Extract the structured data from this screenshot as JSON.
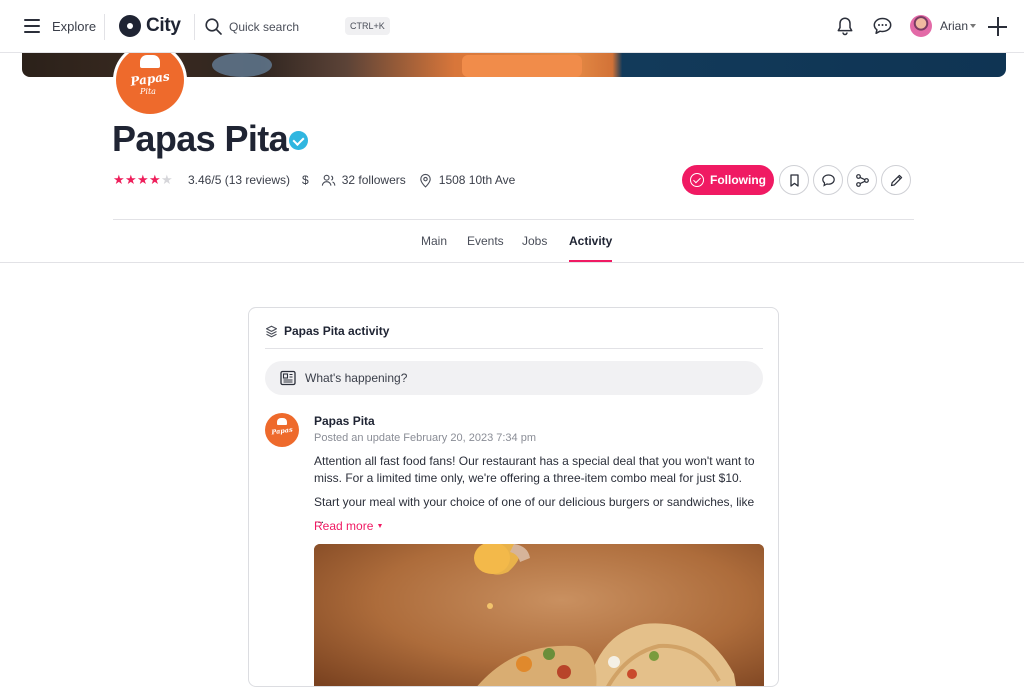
{
  "nav": {
    "explore_label": "Explore",
    "logo_text": "City",
    "search_placeholder": "Quick search",
    "search_shortcut": "CTRL+K",
    "user_name": "Arian"
  },
  "business": {
    "name": "Papas Pita",
    "logo_text_main": "Papas",
    "logo_text_sub": "Pita",
    "rating_stars": 4,
    "rating_max_stars": 5,
    "rating_text": "3.46/5 (13 reviews)",
    "price_level": "$",
    "followers_text": "32 followers",
    "address": "1508 10th Ave"
  },
  "actions": {
    "follow_label": "Following"
  },
  "tabs": [
    {
      "label": "Main"
    },
    {
      "label": "Events"
    },
    {
      "label": "Jobs"
    },
    {
      "label": "Activity"
    }
  ],
  "activity": {
    "title": "Papas Pita activity",
    "composer_placeholder": "What's happening?",
    "post": {
      "author": "Papas Pita",
      "timestamp": "Posted an update February 20, 2023 7:34 pm",
      "paragraphs": [
        "Attention all fast food fans! Our restaurant has a special deal that you won't want to miss. For a limited time only, we're offering a three-item combo meal for just $10.",
        "Start your meal with your choice of one of our delicious burgers or sandwiches, like ..."
      ],
      "read_more": "Read more"
    }
  },
  "colors": {
    "accent": "#f01a63",
    "verified": "#30b6e0",
    "brand_orange": "#ee6a2c"
  }
}
